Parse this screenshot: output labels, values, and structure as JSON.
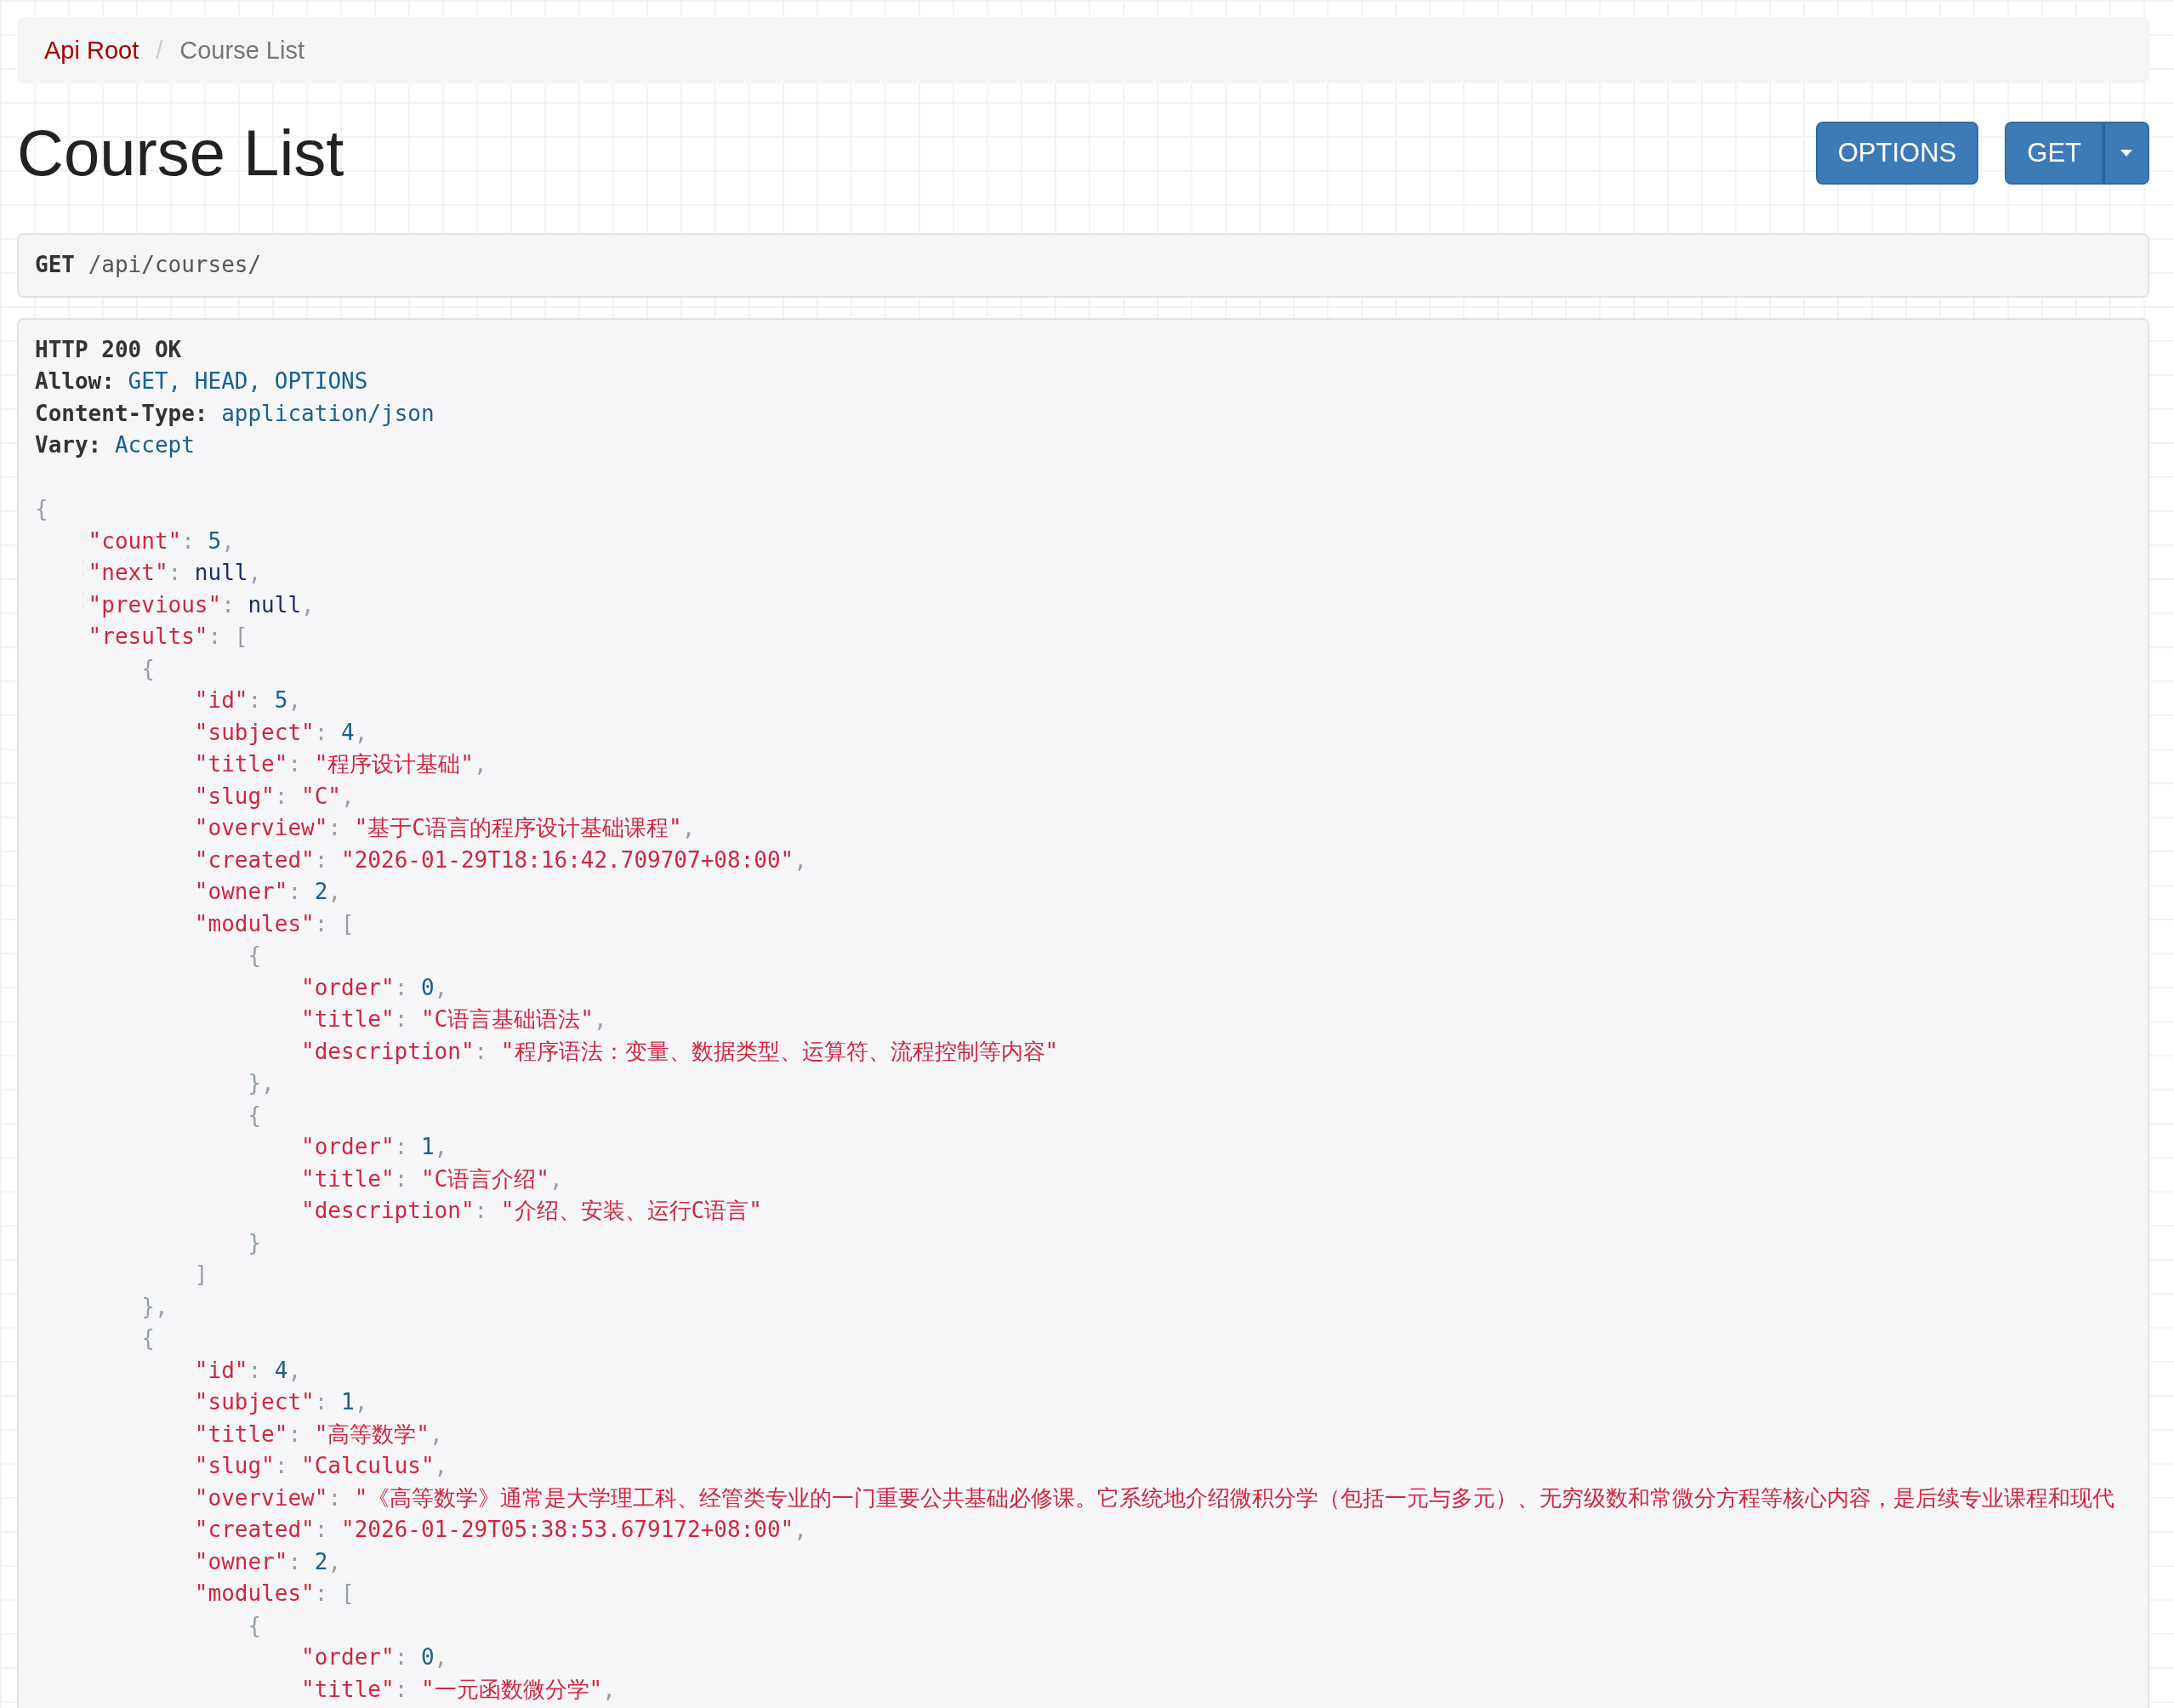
{
  "breadcrumb": {
    "separator": "/",
    "items": [
      {
        "label": "Api Root",
        "selected": false
      },
      {
        "label": "Course List",
        "selected": true
      }
    ]
  },
  "title": "Course List",
  "buttons": [
    {
      "label": "OPTIONS",
      "kind": "plain"
    },
    {
      "label": "GET",
      "kind": "split"
    }
  ],
  "request": {
    "method": "GET",
    "path": "/api/courses/"
  },
  "response": {
    "status": "HTTP 200 OK",
    "headers": [
      {
        "name": "Allow:",
        "value": "GET, HEAD, OPTIONS"
      },
      {
        "name": "Content-Type:",
        "value": "application/json"
      },
      {
        "name": "Vary:",
        "value": "Accept"
      }
    ],
    "body": [
      {
        "bracket": "{",
        "children": [
          {
            "key": "\"count\"",
            "colon": ": ",
            "value": "5",
            "kind": "number",
            "comma": ","
          },
          {
            "key": "\"next\"",
            "colon": ": ",
            "value": "null",
            "kind": "null",
            "comma": ","
          },
          {
            "key": "\"previous\"",
            "colon": ": ",
            "value": "null",
            "kind": "null",
            "comma": ","
          },
          {
            "key": "\"results\"",
            "colon": ": ",
            "bracket": "[",
            "children": [
              {
                "bracket": "{",
                "children": [
                  {
                    "key": "\"id\"",
                    "colon": ": ",
                    "value": "5",
                    "kind": "number",
                    "comma": ","
                  },
                  {
                    "key": "\"subject\"",
                    "colon": ": ",
                    "value": "4",
                    "kind": "number",
                    "comma": ","
                  },
                  {
                    "key": "\"title\"",
                    "colon": ": ",
                    "value": "\"程序设计基础\"",
                    "kind": "string",
                    "comma": ","
                  },
                  {
                    "key": "\"slug\"",
                    "colon": ": ",
                    "value": "\"C\"",
                    "kind": "string",
                    "comma": ","
                  },
                  {
                    "key": "\"overview\"",
                    "colon": ": ",
                    "value": "\"基于C语言的程序设计基础课程\"",
                    "kind": "string",
                    "comma": ","
                  },
                  {
                    "key": "\"created\"",
                    "colon": ": ",
                    "value": "\"2026-01-29T18:16:42.709707+08:00\"",
                    "kind": "string",
                    "comma": ","
                  },
                  {
                    "key": "\"owner\"",
                    "colon": ": ",
                    "value": "2",
                    "kind": "number",
                    "comma": ","
                  },
                  {
                    "key": "\"modules\"",
                    "colon": ": ",
                    "bracket": "[",
                    "children": [
                      {
                        "bracket": "{",
                        "children": [
                          {
                            "key": "\"order\"",
                            "colon": ": ",
                            "value": "0",
                            "kind": "number",
                            "comma": ","
                          },
                          {
                            "key": "\"title\"",
                            "colon": ": ",
                            "value": "\"C语言基础语法\"",
                            "kind": "string",
                            "comma": ","
                          },
                          {
                            "key": "\"description\"",
                            "colon": ": ",
                            "value": "\"程序语法：变量、数据类型、运算符、流程控制等内容\"",
                            "kind": "string"
                          }
                        ]
                      },
                      {
                        "bracket": "}",
                        "comma": ","
                      },
                      {
                        "bracket": "{",
                        "children": [
                          {
                            "key": "\"order\"",
                            "colon": ": ",
                            "value": "1",
                            "kind": "number",
                            "comma": ","
                          },
                          {
                            "key": "\"title\"",
                            "colon": ": ",
                            "value": "\"C语言介绍\"",
                            "kind": "string",
                            "comma": ","
                          },
                          {
                            "key": "\"description\"",
                            "colon": ": ",
                            "value": "\"介绍、安装、运行C语言\"",
                            "kind": "string"
                          }
                        ]
                      },
                      {
                        "bracket": "}"
                      }
                    ]
                  },
                  {
                    "bracket": "]"
                  }
                ]
              },
              {
                "bracket": "}",
                "comma": ","
              },
              {
                "bracket": "{",
                "children": [
                  {
                    "key": "\"id\"",
                    "colon": ": ",
                    "value": "4",
                    "kind": "number",
                    "comma": ","
                  },
                  {
                    "key": "\"subject\"",
                    "colon": ": ",
                    "value": "1",
                    "kind": "number",
                    "comma": ","
                  },
                  {
                    "key": "\"title\"",
                    "colon": ": ",
                    "value": "\"高等数学\"",
                    "kind": "string",
                    "comma": ","
                  },
                  {
                    "key": "\"slug\"",
                    "colon": ": ",
                    "value": "\"Calculus\"",
                    "kind": "string",
                    "comma": ","
                  },
                  {
                    "key": "\"overview\"",
                    "colon": ": ",
                    "value": "\"《高等数学》通常是大学理工科、经管类专业的一门重要公共基础必修课。它系统地介绍微积分学（包括一元与多元）、无穷级数和常微分方程等核心内容，是后续专业课程和现代",
                    "kind": "string"
                  },
                  {
                    "key": "\"created\"",
                    "colon": ": ",
                    "value": "\"2026-01-29T05:38:53.679172+08:00\"",
                    "kind": "string",
                    "comma": ","
                  },
                  {
                    "key": "\"owner\"",
                    "colon": ": ",
                    "value": "2",
                    "kind": "number",
                    "comma": ","
                  },
                  {
                    "key": "\"modules\"",
                    "colon": ": ",
                    "bracket": "[",
                    "children": [
                      {
                        "bracket": "{",
                        "children": [
                          {
                            "key": "\"order\"",
                            "colon": ": ",
                            "value": "0",
                            "kind": "number",
                            "comma": ","
                          },
                          {
                            "key": "\"title\"",
                            "colon": ": ",
                            "value": "\"一元函数微分学\"",
                            "kind": "string",
                            "comma": ","
                          }
                        ]
                      }
                    ]
                  }
                ]
              }
            ]
          }
        ]
      }
    ]
  }
}
